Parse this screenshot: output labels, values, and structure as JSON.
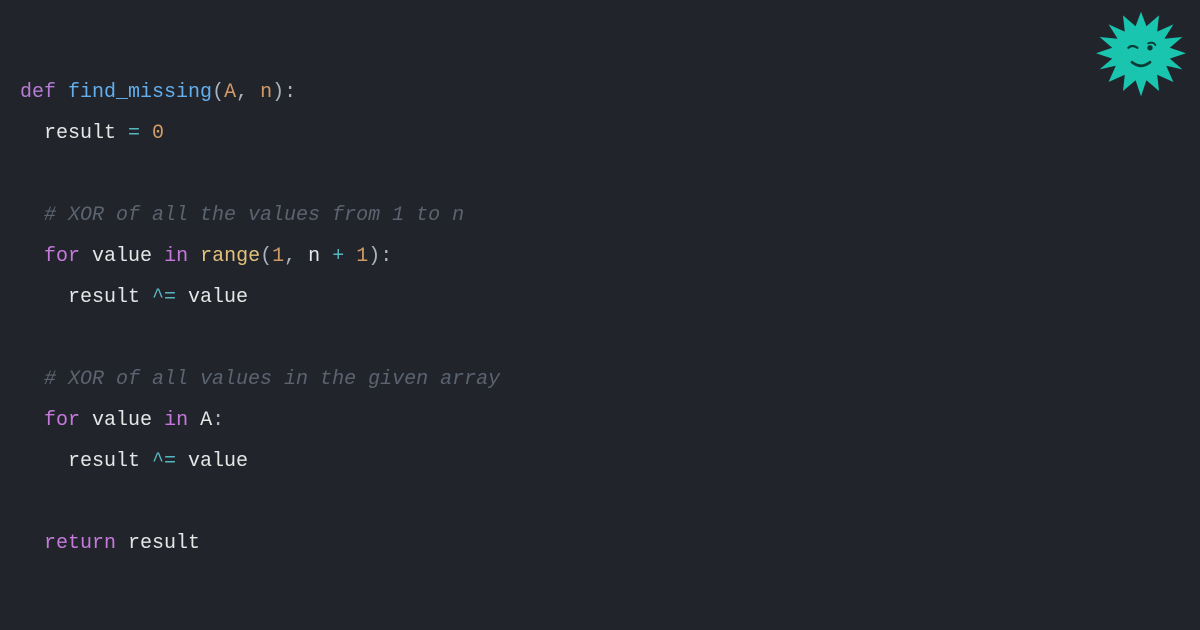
{
  "mascot": {
    "color": "#1ac5b0"
  },
  "code": {
    "l1": {
      "def": "def",
      "func": "find_missing",
      "open": "(",
      "pA": "A",
      "c1": ", ",
      "pn": "n",
      "close": "):"
    },
    "l2": {
      "var": "result",
      "eq": " = ",
      "zero": "0"
    },
    "l3": {
      "comment": "# XOR of all the values from 1 to n"
    },
    "l4": {
      "for": "for",
      "sp1": " ",
      "val": "value",
      "sp2": " ",
      "in": "in",
      "sp3": " ",
      "range": "range",
      "open": "(",
      "one": "1",
      "c1": ", ",
      "n": "n",
      "plus": " + ",
      "one2": "1",
      "close": "):"
    },
    "l5": {
      "var": "result",
      "op": " ^= ",
      "val": "value"
    },
    "l6": {
      "comment": "# XOR of all values in the given array"
    },
    "l7": {
      "for": "for",
      "sp1": " ",
      "val": "value",
      "sp2": " ",
      "in": "in",
      "sp3": " ",
      "A": "A",
      "colon": ":"
    },
    "l8": {
      "var": "result",
      "op": " ^= ",
      "val": "value"
    },
    "l9": {
      "ret": "return",
      "sp": " ",
      "var": "result"
    }
  }
}
